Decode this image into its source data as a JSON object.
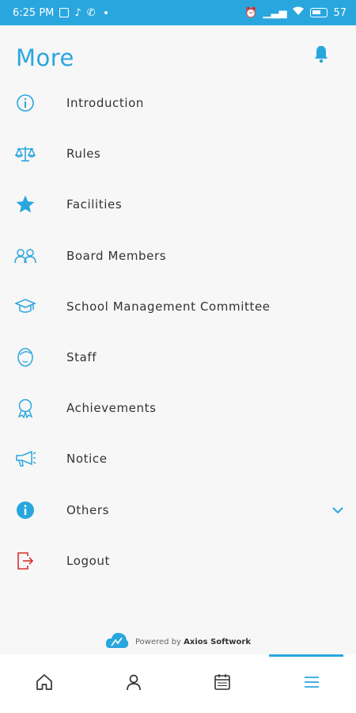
{
  "status": {
    "time": "6:25 PM",
    "battery": "57"
  },
  "header": {
    "title": "More"
  },
  "menu": {
    "items": [
      {
        "label": "Introduction",
        "icon": "info-circle-icon"
      },
      {
        "label": "Rules",
        "icon": "scales-icon"
      },
      {
        "label": "Facilities",
        "icon": "star-icon"
      },
      {
        "label": "Board Members",
        "icon": "users-icon"
      },
      {
        "label": "School Management Committee",
        "icon": "graduation-cap-icon"
      },
      {
        "label": "Staff",
        "icon": "face-icon"
      },
      {
        "label": "Achievements",
        "icon": "award-icon"
      },
      {
        "label": "Notice",
        "icon": "megaphone-icon"
      },
      {
        "label": "Others",
        "icon": "info-filled-icon",
        "has_dropdown": true
      },
      {
        "label": "Logout",
        "icon": "logout-icon"
      }
    ]
  },
  "footer": {
    "powered_prefix": "Powered by",
    "powered_brand": "Axios Softwork"
  },
  "bottom_nav": {
    "items": [
      {
        "icon": "home-icon"
      },
      {
        "icon": "user-icon"
      },
      {
        "icon": "calendar-icon"
      },
      {
        "icon": "menu-icon",
        "active": true
      }
    ]
  },
  "colors": {
    "accent": "#2aa6de",
    "logout": "#d9312b"
  }
}
